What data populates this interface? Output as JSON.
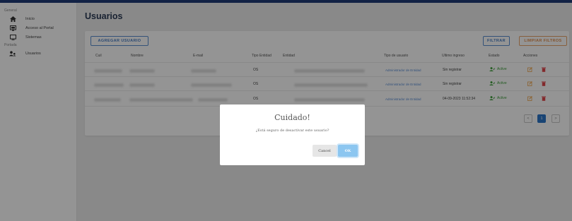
{
  "sidebar": {
    "sections": [
      {
        "label": "General",
        "items": [
          {
            "label": "Inicio",
            "icon": "home-icon"
          },
          {
            "label": "Acceso al Portal",
            "icon": "portal-icon"
          },
          {
            "label": "Sistemas",
            "icon": "monitor-icon"
          }
        ]
      },
      {
        "label": "Portada",
        "items": [
          {
            "label": "Usuarios",
            "icon": "users-icon"
          }
        ]
      }
    ]
  },
  "page": {
    "title": "Usuarios"
  },
  "toolbar": {
    "add_label": "AGREGAR USUARIO",
    "filter_label": "FILTRAR",
    "clear_label": "LIMPIAR FILTROS"
  },
  "table": {
    "headers": [
      "Cuil",
      "Nombre",
      "E-mail",
      "Tipo Entidad",
      "Entidad",
      "Tipo de usuario",
      "Ultimo ingreso",
      "Estado",
      "Acciones"
    ],
    "rows": [
      {
        "tipo_entidad": "OS",
        "tipo_usuario": "Administrador de Entidad",
        "ultimo_ingreso": "Sin registrar",
        "estado": "Active"
      },
      {
        "tipo_entidad": "OS",
        "tipo_usuario": "Administrador de Entidad",
        "ultimo_ingreso": "Sin registrar",
        "estado": "Active"
      },
      {
        "tipo_entidad": "OS",
        "tipo_usuario": "Administrador de Entidad",
        "ultimo_ingreso": "04-09-2023 11:52:34",
        "estado": "Active"
      }
    ]
  },
  "pagination": {
    "prev": "<",
    "current": "1",
    "next": ">"
  },
  "modal": {
    "title": "Cuidado!",
    "message": "¿Está seguro de desactivar este usuario?",
    "cancel_label": "Cancel",
    "ok_label": "OK"
  },
  "colors": {
    "accent": "#4a7fc4",
    "topbar": "#1f3b78",
    "active": "#3d9e3a",
    "delete": "#e0474c",
    "edit": "#f0a64a",
    "ok_button": "#8cc6f0"
  }
}
